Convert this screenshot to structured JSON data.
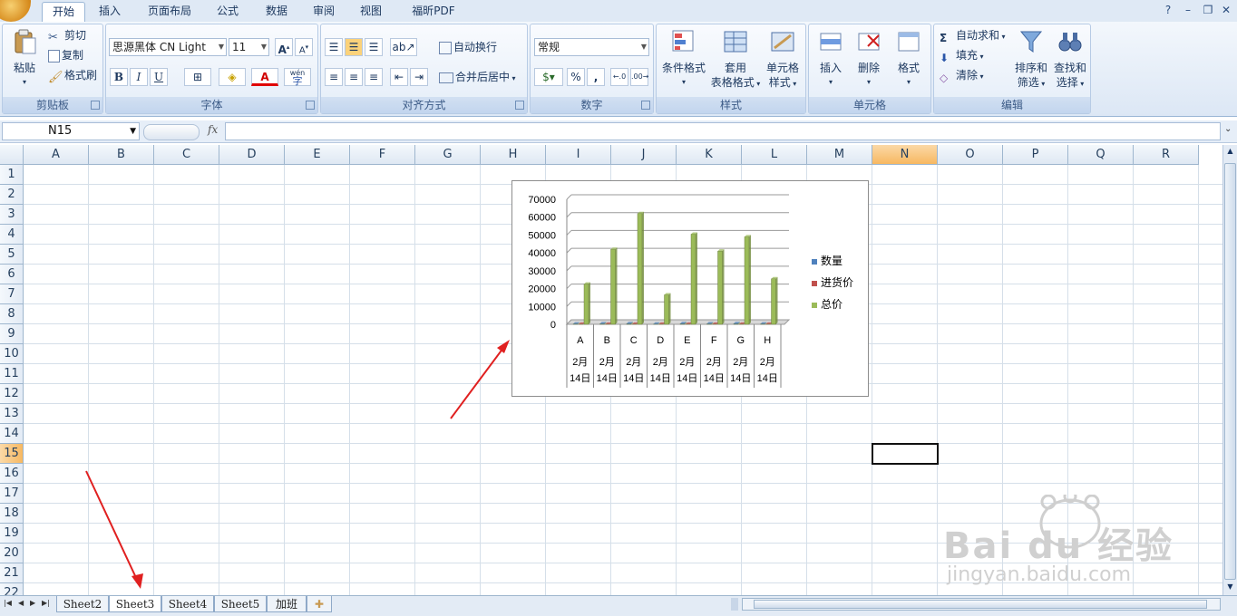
{
  "tabs": [
    "开始",
    "插入",
    "页面布局",
    "公式",
    "数据",
    "审阅",
    "视图",
    "福昕PDF"
  ],
  "active_tab": "开始",
  "ribbon": {
    "clipboard": {
      "title": "剪贴板",
      "paste": "粘贴",
      "cut": "剪切",
      "copy": "复制",
      "format_painter": "格式刷"
    },
    "font": {
      "title": "字体",
      "font_name": "思源黑体 CN Light",
      "font_size": "11",
      "bold": "B",
      "italic": "I",
      "underline": "U",
      "wen": "wén"
    },
    "alignment": {
      "title": "对齐方式",
      "wrap_text": "自动换行",
      "merge_center": "合并后居中"
    },
    "number": {
      "title": "数字",
      "format": "常规",
      "percent": "%",
      "comma": ","
    },
    "styles": {
      "title": "样式",
      "conditional": "条件格式",
      "table_line1": "套用",
      "table_line2": "表格格式",
      "cell_style_line1": "单元格",
      "cell_style_line2": "样式"
    },
    "cells": {
      "title": "单元格",
      "insert": "插入",
      "delete": "删除",
      "format": "格式"
    },
    "editing": {
      "title": "编辑",
      "autosum": "自动求和",
      "fill": "填充",
      "clear": "清除",
      "sort_line1": "排序和",
      "sort_line2": "筛选",
      "find_line1": "查找和",
      "find_line2": "选择"
    }
  },
  "formula_bar": {
    "name_box": "N15",
    "fx": "fx",
    "formula": ""
  },
  "columns": [
    "A",
    "B",
    "C",
    "D",
    "E",
    "F",
    "G",
    "H",
    "I",
    "J",
    "K",
    "L",
    "M",
    "N",
    "O",
    "P",
    "Q",
    "R"
  ],
  "rows": [
    "1",
    "2",
    "3",
    "4",
    "5",
    "6",
    "7",
    "8",
    "9",
    "10",
    "11",
    "12",
    "13",
    "14",
    "15",
    "16",
    "17",
    "18",
    "19",
    "20",
    "21",
    "22"
  ],
  "selected_cell": "N15",
  "chart_data": {
    "type": "bar",
    "style": "3d-clustered-column",
    "categories": [
      "A 2月14日",
      "B 2月14日",
      "C 2月14日",
      "D 2月14日",
      "E 2月14日",
      "F 2月14日",
      "G 2月14日",
      "H 2月14日"
    ],
    "category_top": [
      "A",
      "B",
      "C",
      "D",
      "E",
      "F",
      "G",
      "H"
    ],
    "category_bottom_1": [
      "2月",
      "2月",
      "2月",
      "2月",
      "2月",
      "2月",
      "2月",
      "2月"
    ],
    "category_bottom_2": [
      "14日",
      "14日",
      "14日",
      "14日",
      "14日",
      "14日",
      "14日",
      "14日"
    ],
    "series": [
      {
        "name": "数量",
        "color": "#4f81bd",
        "values": [
          200,
          300,
          400,
          150,
          350,
          300,
          350,
          200
        ]
      },
      {
        "name": "进货价",
        "color": "#c0504d",
        "values": [
          100,
          150,
          150,
          100,
          150,
          140,
          140,
          120
        ]
      },
      {
        "name": "总价",
        "color": "#9bbb59",
        "values": [
          22500,
          42000,
          62000,
          16500,
          50500,
          41000,
          49000,
          25500
        ]
      }
    ],
    "y_ticks": [
      "70000",
      "60000",
      "50000",
      "40000",
      "30000",
      "20000",
      "10000",
      "0"
    ],
    "ylim": [
      0,
      70000
    ],
    "grid": true,
    "legend": "right"
  },
  "sheets": [
    "Sheet2",
    "Sheet3",
    "Sheet4",
    "Sheet5",
    "加班"
  ],
  "active_sheet": "Sheet3",
  "watermark": {
    "brand": "Bai du 经验",
    "url": "jingyan.baidu.com"
  }
}
